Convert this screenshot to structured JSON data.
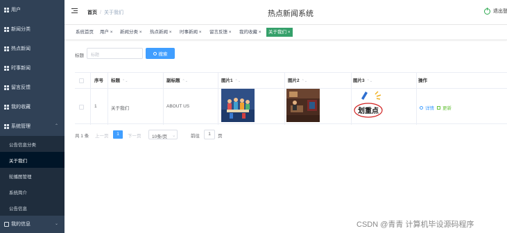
{
  "app": {
    "title": "热点新闻系统"
  },
  "sidebar": {
    "items": [
      {
        "label": "用户"
      },
      {
        "label": "新闻分类"
      },
      {
        "label": "热点新闻"
      },
      {
        "label": "时事新闻"
      },
      {
        "label": "留言反馈"
      },
      {
        "label": "我的收藏"
      },
      {
        "label": "系统管理"
      }
    ],
    "submenu": [
      {
        "label": "公告信息分类"
      },
      {
        "label": "关于我们"
      },
      {
        "label": "轮播图管理"
      },
      {
        "label": "系统简介"
      },
      {
        "label": "公告信息"
      }
    ],
    "last": {
      "label": "我的信息"
    }
  },
  "header": {
    "breadcrumb_home": "首页",
    "breadcrumb_sep": "/",
    "breadcrumb_current": "关于我们",
    "logout": "退出登"
  },
  "tags": [
    {
      "label": "系统首页"
    },
    {
      "label": "用户 ×"
    },
    {
      "label": "新闻分类 ×"
    },
    {
      "label": "热点新闻 ×"
    },
    {
      "label": "时事新闻 ×"
    },
    {
      "label": "留言反馈 ×"
    },
    {
      "label": "我的收藏 ×"
    },
    {
      "label": "关于我们 ×"
    }
  ],
  "search": {
    "label": "标题",
    "placeholder": "标题",
    "button": "搜索"
  },
  "table": {
    "headers": {
      "seq": "序号",
      "title": "标题",
      "subtitle": "副标题",
      "pic1": "图片1",
      "pic2": "图片2",
      "pic3": "图片3",
      "ops": "操作"
    },
    "sort_mark": "⌃⌄",
    "row": {
      "seq": "1",
      "title": "关于我们",
      "subtitle": "ABOUT US",
      "pic3_text": "划重点"
    },
    "actions": {
      "detail": "详情",
      "update": "更新"
    }
  },
  "pagination": {
    "total": "共 1 条",
    "prev": "上一页",
    "current": "1",
    "next": "下一页",
    "page_size": "10条/页",
    "goto": "前往",
    "goto_value": "1",
    "page_unit": "页"
  },
  "watermark": "CSDN @青青  计算机毕设源码程序",
  "colors": {
    "sidebar": "#304156",
    "primary": "#409eff",
    "active_tag": "#35a06a",
    "link_blue": "#409eff",
    "link_green": "#67c23a"
  }
}
